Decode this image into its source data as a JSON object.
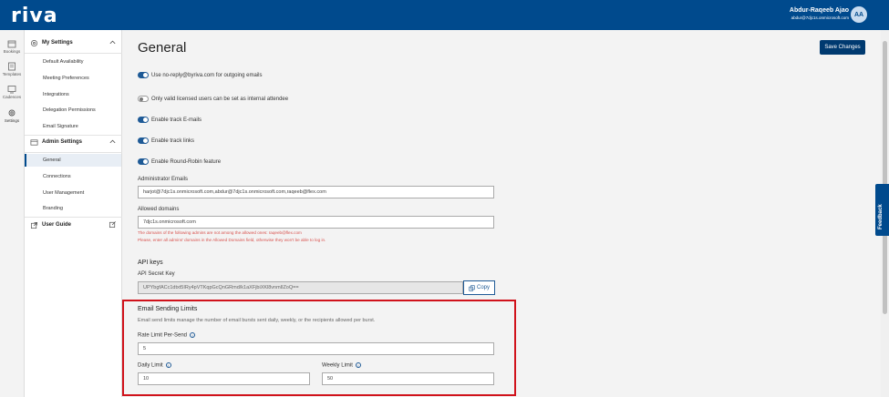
{
  "app": {
    "logo": "riva"
  },
  "user": {
    "name": "Abdur-Raqeeb Ajao",
    "email": "abdur@7djc1s.onmicrosoft.com",
    "initials": "AA"
  },
  "rail": [
    {
      "label": "Bookings",
      "icon": "calendar-icon"
    },
    {
      "label": "Templates",
      "icon": "template-icon"
    },
    {
      "label": "Cadences",
      "icon": "cadence-icon"
    },
    {
      "label": "Settings",
      "icon": "gear-icon"
    }
  ],
  "sidebar": {
    "my_settings": "My Settings",
    "my_items": [
      "Default Availability",
      "Meeting Preferences",
      "Integrations",
      "Delegation Permissions",
      "Email Signature"
    ],
    "admin_settings": "Admin Settings",
    "admin_items": [
      "General",
      "Connections",
      "User Management",
      "Branding"
    ],
    "user_guide": "User Guide"
  },
  "main": {
    "title": "General",
    "save_label": "Save Changes",
    "toggles": [
      {
        "label": "Use no-reply@byriva.com for outgoing emails",
        "on": true
      },
      {
        "label": "Only valid licensed users can be set as internal attendee",
        "on": false
      },
      {
        "label": "Enable track E-mails",
        "on": true
      },
      {
        "label": "Enable track links",
        "on": true
      },
      {
        "label": "Enable Round-Robin feature",
        "on": true
      }
    ],
    "admin_emails_label": "Administrator Emails",
    "admin_emails_value": "harjot@7djc1s.onmicrosoft.com,abdur@7djc1s.onmicrosoft.com,raqeeb@flex.com",
    "allowed_domains_label": "Allowed domains",
    "allowed_domains_value": "7djc1s.onmicrosoft.com",
    "error_line1": "The domains of the following admins are not among the allowed ones: raqeeb@flex.com",
    "error_line2": "Please, enter all admins' domains in the Allowed Domains field, otherwise they won't be able to log in.",
    "api_keys_title": "API keys",
    "api_secret_label": "API Secret Key",
    "api_secret_value": "UPYbgfACc1dtxt5IRy4pVTKqpGcQnGRmd/k1aXFjbiXKl8vnmIlZoQ==",
    "copy_label": "Copy",
    "email_limits_title": "Email Sending Limits",
    "email_limits_desc": "Email send limits manage the number of email bursts sent daily, weekly, or the recipients allowed per burst.",
    "rate_limit_label": "Rate Limit Per-Send",
    "rate_limit_value": "5",
    "daily_limit_label": "Daily Limit",
    "daily_limit_value": "10",
    "weekly_limit_label": "Weekly Limit",
    "weekly_limit_value": "50"
  },
  "feedback_label": "Feedback",
  "colors": {
    "brand": "#004a8d",
    "highlight": "#d0121b",
    "error": "#d9534f"
  }
}
